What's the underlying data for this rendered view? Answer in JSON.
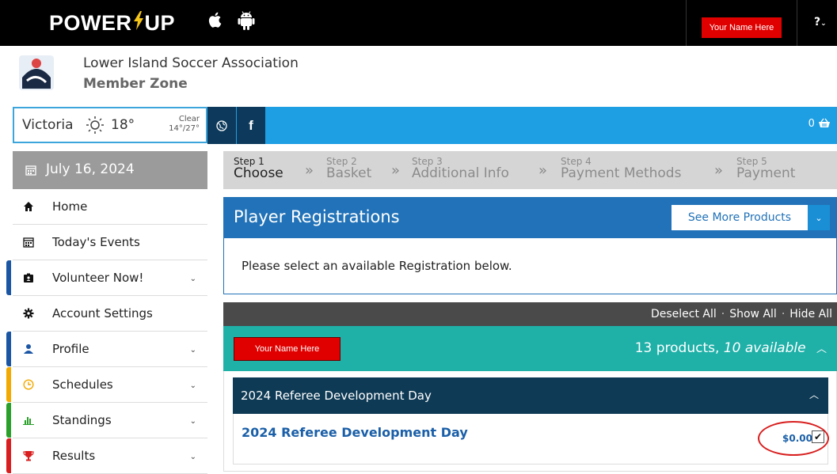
{
  "topbar": {
    "logo_left": "POWER",
    "logo_right": "UP",
    "user_name": "Your Name Here",
    "help_label": "?"
  },
  "association": {
    "name": "Lower Island Soccer Association",
    "zone": "Member Zone"
  },
  "weather": {
    "city": "Victoria",
    "temperature": "18°",
    "condition": "Clear",
    "range": "14°/27°"
  },
  "basket": {
    "count": "0"
  },
  "sidebar": {
    "date": "July 16, 2024",
    "items": [
      {
        "label": "Home",
        "icon": "home-icon",
        "has_chevron": false,
        "accent": ""
      },
      {
        "label": "Today's Events",
        "icon": "calendar-icon",
        "has_chevron": false,
        "accent": ""
      },
      {
        "label": "Volunteer Now!",
        "icon": "id-card-icon",
        "has_chevron": true,
        "accent": "#1b56a4"
      },
      {
        "label": "Account Settings",
        "icon": "gear-icon",
        "has_chevron": false,
        "accent": ""
      },
      {
        "label": "Profile",
        "icon": "user-icon",
        "has_chevron": true,
        "accent": "#1b56a4"
      },
      {
        "label": "Schedules",
        "icon": "clock-icon",
        "has_chevron": true,
        "accent": "#f2a900"
      },
      {
        "label": "Standings",
        "icon": "bar-chart-icon",
        "has_chevron": true,
        "accent": "#2aa02a"
      },
      {
        "label": "Results",
        "icon": "trophy-icon",
        "has_chevron": true,
        "accent": "#d81e1e"
      }
    ]
  },
  "steps": [
    {
      "num": "Step 1",
      "label": "Choose"
    },
    {
      "num": "Step 2",
      "label": "Basket"
    },
    {
      "num": "Step 3",
      "label": "Additional Info"
    },
    {
      "num": "Step 4",
      "label": "Payment Methods"
    },
    {
      "num": "Step 5",
      "label": "Payment"
    }
  ],
  "products": {
    "title": "Player Registrations",
    "see_more": "See More Products",
    "notice": "Please select an available Registration below.",
    "actions": [
      "Deselect All",
      "Show All",
      "Hide All"
    ],
    "member_name": "Your Name Here",
    "count_text": "13 products, ",
    "available_text": "10 available",
    "group_title": "2024 Referee Development Day",
    "product_name": "2024 Referee Development Day",
    "price": "$0.00"
  },
  "colors": {
    "brand_bolt": "#f5c518",
    "accent_blue": "#1e9ee3",
    "header_blue": "#2172b8",
    "teal": "#1fb0a8",
    "dark_navy": "#0e3a55",
    "highlight_red": "#d81e1e"
  }
}
